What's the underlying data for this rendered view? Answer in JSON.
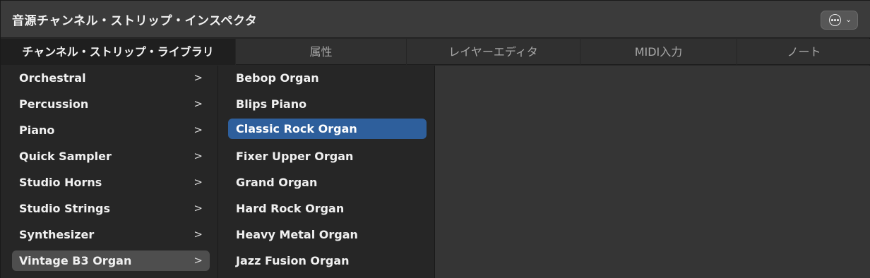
{
  "window": {
    "title": "音源チャンネル・ストリップ・インスペクタ",
    "menu_button_icon": "ellipsis-circle-icon",
    "menu_chevron": "⌄"
  },
  "tabs": [
    {
      "label": "チャンネル・ストリップ・ライブラリ",
      "active": true
    },
    {
      "label": "属性",
      "active": false
    },
    {
      "label": "レイヤーエディタ",
      "active": false
    },
    {
      "label": "MIDI入力",
      "active": false
    },
    {
      "label": "ノート",
      "active": false
    }
  ],
  "categories": [
    {
      "label": "Orchestral",
      "arrow": ">",
      "selected": false
    },
    {
      "label": "Percussion",
      "arrow": ">",
      "selected": false
    },
    {
      "label": "Piano",
      "arrow": ">",
      "selected": false
    },
    {
      "label": "Quick Sampler",
      "arrow": ">",
      "selected": false
    },
    {
      "label": "Studio Horns",
      "arrow": ">",
      "selected": false
    },
    {
      "label": "Studio Strings",
      "arrow": ">",
      "selected": false
    },
    {
      "label": "Synthesizer",
      "arrow": ">",
      "selected": false
    },
    {
      "label": "Vintage B3 Organ",
      "arrow": ">",
      "selected": true
    }
  ],
  "patches": [
    {
      "label": "Bebop Organ",
      "selected": false
    },
    {
      "label": "Blips Piano",
      "selected": false
    },
    {
      "label": "Classic Rock Organ",
      "selected": true
    },
    {
      "label": "Fixer Upper Organ",
      "selected": false
    },
    {
      "label": "Grand Organ",
      "selected": false
    },
    {
      "label": "Hard Rock Organ",
      "selected": false
    },
    {
      "label": "Heavy Metal Organ",
      "selected": false
    },
    {
      "label": "Jazz Fusion Organ",
      "selected": false
    }
  ],
  "colors": {
    "selection_accent": "#2e5f9c",
    "category_selection": "#4e4e4e",
    "background": "#262626"
  }
}
